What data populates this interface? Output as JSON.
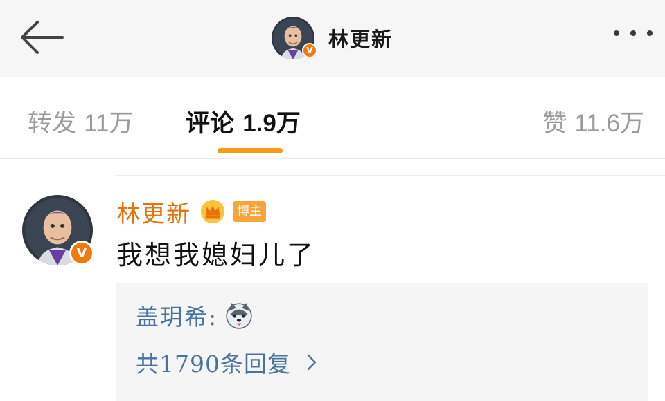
{
  "header": {
    "title": "林更新",
    "verified_badge": "V"
  },
  "tabs": [
    {
      "label": "转发",
      "count": "11万"
    },
    {
      "label": "评论",
      "count": "1.9万"
    },
    {
      "label": "赞",
      "count": "11.6万"
    }
  ],
  "active_tab": "评论",
  "comment": {
    "author": "林更新",
    "tag": "博主",
    "verified_badge": "V",
    "text": "我想我媳妇儿了",
    "reply_preview": {
      "author": "盖玥希:",
      "emoji": "husky-dog-emoji"
    },
    "reply_count_label": "共1790条回复"
  },
  "colors": {
    "accent": "#f79a14",
    "author_name": "#e8730c",
    "link_blue": "#4a73a0",
    "header_bg": "#f6f6f6",
    "muted_text": "#9a9a9a"
  },
  "icons": {
    "back": "back-arrow-icon",
    "more": "more-dots-icon",
    "crown": "crown-icon",
    "chevron": "chevron-right-icon"
  }
}
